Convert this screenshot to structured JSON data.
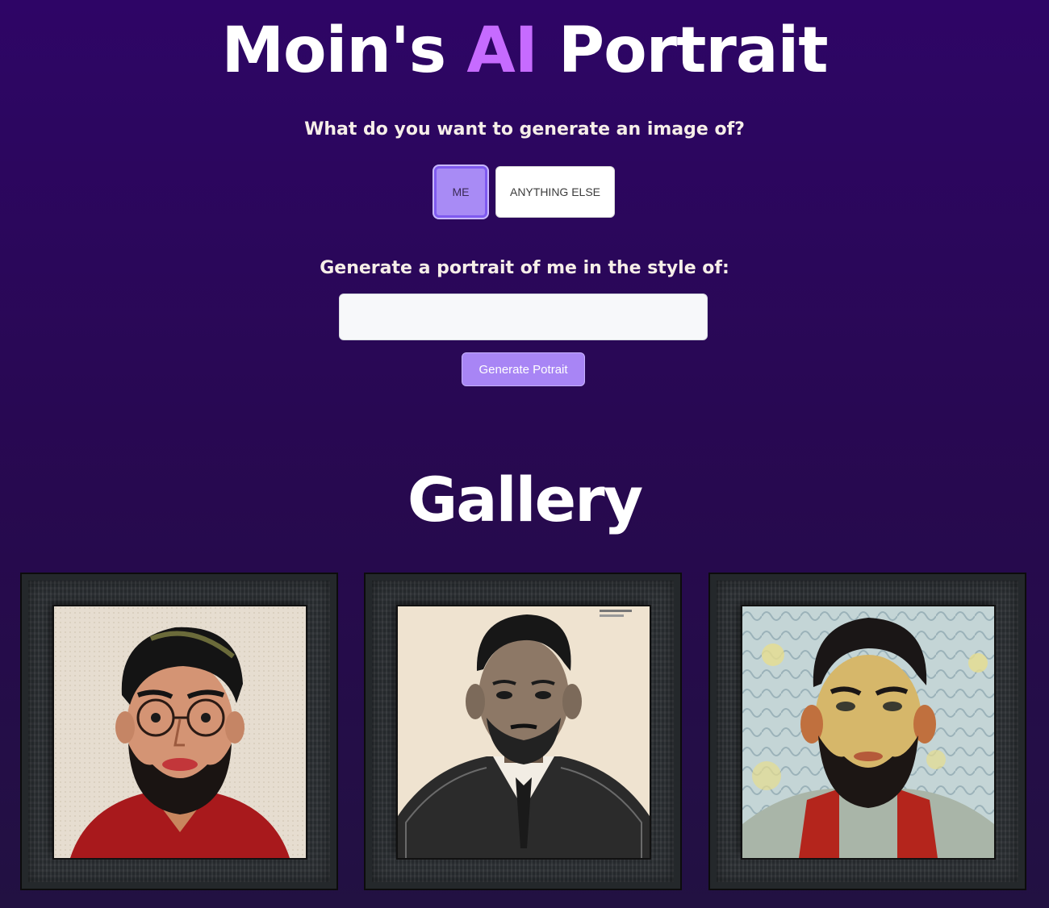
{
  "header": {
    "title_part1": "Moin's",
    "title_accent": "AI",
    "title_part2": "Portrait",
    "accent_color": "#c66bff"
  },
  "mode_selector": {
    "question": "What do you want to generate an image of?",
    "options": [
      "ME",
      "ANYTHING ELSE"
    ],
    "selected": "ME"
  },
  "prompt": {
    "label": "Generate a portrait of me in the style of:",
    "value": "",
    "placeholder": "",
    "button_label": "Generate Potrait"
  },
  "gallery": {
    "title": "Gallery",
    "items": [
      {
        "style": "flat-illustration",
        "icon": "portrait-image"
      },
      {
        "style": "sketch",
        "icon": "portrait-image"
      },
      {
        "style": "impressionist-painting",
        "icon": "portrait-image"
      }
    ]
  },
  "colors": {
    "background_top": "#2e0566",
    "background_bottom": "#221142",
    "primary_button": "#a885f5"
  }
}
